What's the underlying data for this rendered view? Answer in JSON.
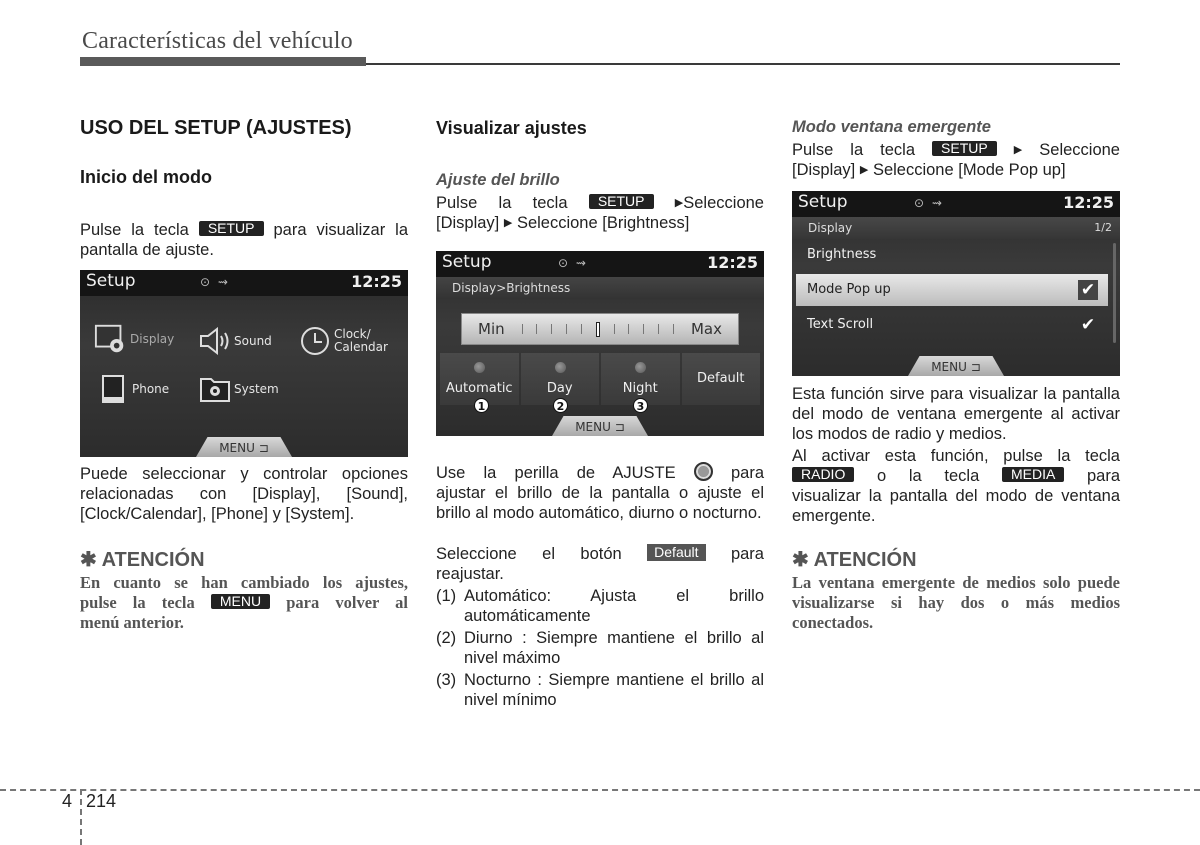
{
  "header": {
    "title": "Características del vehículo"
  },
  "col1": {
    "heading": "USO DEL SETUP (AJUSTES)",
    "subheading": "Inicio del modo",
    "intro_pre": "Pulse la tecla",
    "intro_key": "SETUP",
    "intro_post": "para visualizar la",
    "intro_line2": "pantalla de ajuste.",
    "screen": {
      "title": "Setup",
      "status_icons": "⊙ ⇝",
      "time": "12:25",
      "items": [
        {
          "label": "Display",
          "icon": "display-settings-icon"
        },
        {
          "label": "Sound",
          "icon": "speaker-icon"
        },
        {
          "label": "Clock/\nCalendar",
          "label_line1": "Clock/",
          "label_line2": "Calendar",
          "icon": "clock-icon"
        },
        {
          "label": "Phone",
          "icon": "phone-icon"
        },
        {
          "label": "System",
          "icon": "folder-gear-icon"
        }
      ],
      "menu_label": "MENU ⊐"
    },
    "body_lines": [
      "Puede seleccionar y controlar opciones",
      "relacionadas con [Display], [Sound],",
      "[Clock/Calendar], [Phone] y [System]."
    ],
    "attention": {
      "symbol": "✱",
      "title": "ATENCIÓN",
      "line1": "En cuanto se han cambiado los ajustes,",
      "line2_pre": "pulse la tecla",
      "line2_key": "MENU",
      "line2_post": "para volver al",
      "line3": "menú anterior."
    }
  },
  "col2": {
    "heading": "Visualizar ajustes",
    "subheading": "Ajuste del brillo",
    "instr_pre": "Pulse la tecla",
    "instr_key": "SETUP",
    "instr_sel1": "Seleccione",
    "instr_line2_a": "[Display]",
    "instr_line2_b": "Seleccione [Brightness]",
    "screen": {
      "title": "Setup",
      "status_icons": "⊙ ⇝",
      "time": "12:25",
      "breadcrumb": "Display>Brightness",
      "slider_min": "Min",
      "slider_max": "Max",
      "slider_level": 0.5,
      "slider_ticks": 11,
      "modes": [
        {
          "label": "Automatic",
          "badge": "1"
        },
        {
          "label": "Day",
          "badge": "2"
        },
        {
          "label": "Night",
          "badge": "3"
        },
        {
          "label": "Default",
          "badge": ""
        }
      ],
      "menu_label": "MENU ⊐"
    },
    "para1_line1_pre": "Use la perilla de AJUSTE",
    "para1_line1_post": "para",
    "para1_rest": "ajustar el brillo de la pantalla o ajuste el brillo al modo automático, diurno o nocturno.",
    "para2_pre": "Seleccione el botón",
    "para2_key": "Default",
    "para2_post": "para",
    "para2_line2": "reajustar.",
    "list": [
      {
        "num": "(1)",
        "text": "Automático: Ajusta el brillo automáticamente"
      },
      {
        "num": "(2)",
        "text": "Diurno : Siempre mantiene el brillo al nivel máximo"
      },
      {
        "num": "(3)",
        "text": "Nocturno : Siempre mantiene el brillo al nivel mínimo"
      }
    ]
  },
  "col3": {
    "subheading": "Modo ventana emergente",
    "instr_pre": "Pulse la tecla",
    "instr_key": "SETUP",
    "instr_sel1": "Seleccione",
    "instr_line2_a": "[Display]",
    "instr_line2_b": "Seleccione [Mode Pop up]",
    "screen": {
      "title": "Setup",
      "status_icons": "⊙ ⇝",
      "time": "12:25",
      "section": "Display",
      "page": "1/2",
      "rows": [
        {
          "label": "Brightness",
          "checked": false,
          "selected": false
        },
        {
          "label": "Mode Pop up",
          "checked": true,
          "selected": true
        },
        {
          "label": "Text Scroll",
          "checked": true,
          "selected": false
        }
      ],
      "check_glyph": "✔",
      "menu_label": "MENU ⊐"
    },
    "para1": "Esta función sirve para visualizar la pantalla del modo de ventana emergente al activar los modos de radio y medios.",
    "para2_line1": "Al activar esta función, pulse la tecla",
    "para2_key1": "RADIO",
    "para2_mid": "o la tecla",
    "para2_key2": "MEDIA",
    "para2_post": "para",
    "para2_rest": "visualizar la pantalla del modo de ventana emergente.",
    "attention": {
      "symbol": "✱",
      "title": "ATENCIÓN",
      "body": "La ventana emergente de medios solo puede visualizarse si hay dos o más medios conectados."
    }
  },
  "footer": {
    "chapter": "4",
    "page": "214"
  },
  "glyphs": {
    "triangle": "▶"
  }
}
